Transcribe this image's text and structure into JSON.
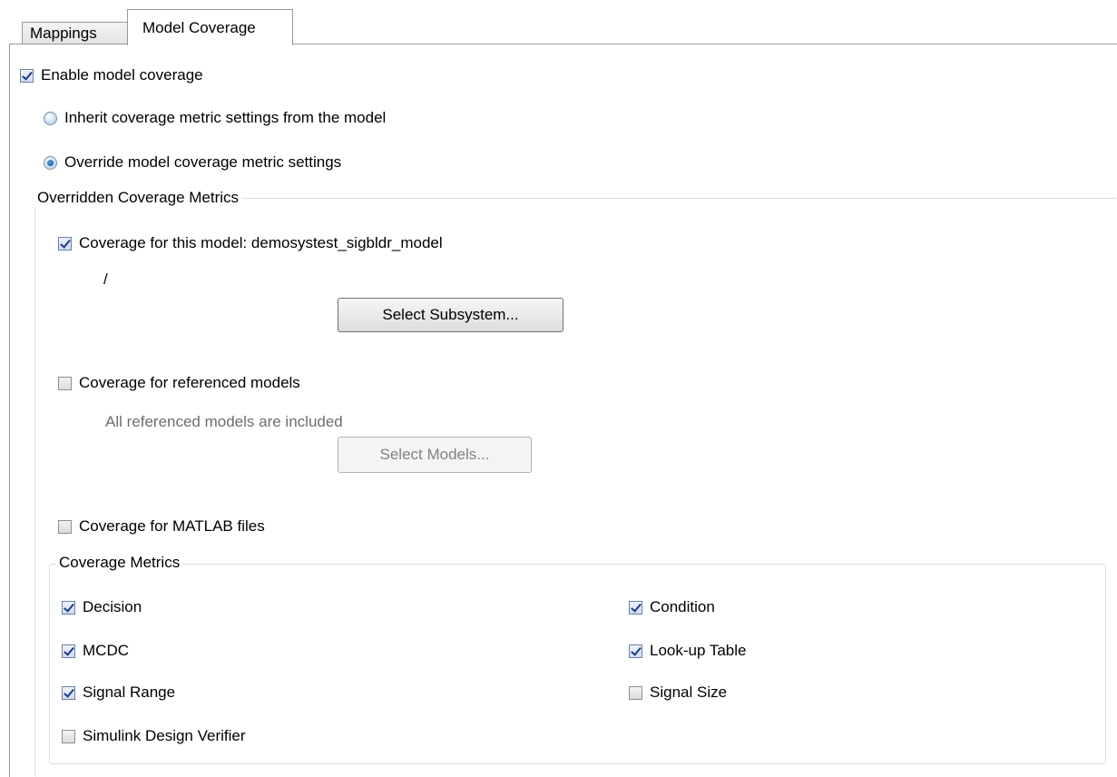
{
  "tabs": [
    {
      "label": "Mappings",
      "active": false
    },
    {
      "label": "Model Coverage",
      "active": true
    }
  ],
  "enable_coverage": {
    "label": "Enable model coverage",
    "checked": true
  },
  "inherit_option": {
    "label": "Inherit coverage metric settings from the model",
    "selected": false
  },
  "override_option": {
    "label": "Override model coverage metric settings",
    "selected": true
  },
  "overridden_group": {
    "title": "Overridden Coverage Metrics",
    "this_model": {
      "label": "Coverage for this model: demosystest_sigbldr_model",
      "checked": true
    },
    "subsystem_path": "/",
    "select_subsystem_label": "Select Subsystem...",
    "referenced_models": {
      "label": "Coverage for referenced models",
      "checked": false
    },
    "referenced_note": "All referenced models are included",
    "select_models_label": "Select Models...",
    "matlab_files": {
      "label": "Coverage for MATLAB files",
      "checked": false
    }
  },
  "metrics_group": {
    "title": "Coverage Metrics",
    "items": [
      {
        "label": "Decision",
        "checked": true
      },
      {
        "label": "Condition",
        "checked": true
      },
      {
        "label": "MCDC",
        "checked": true
      },
      {
        "label": "Look-up Table",
        "checked": true
      },
      {
        "label": "Signal Range",
        "checked": true
      },
      {
        "label": "Signal Size",
        "checked": false
      },
      {
        "label": "Simulink Design Verifier",
        "checked": false
      }
    ]
  }
}
